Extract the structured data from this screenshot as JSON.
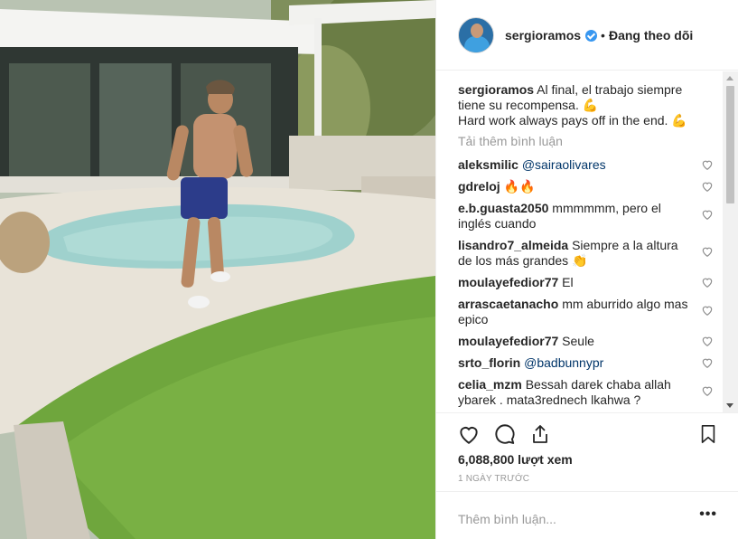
{
  "header": {
    "username": "sergioramos",
    "separator": "•",
    "follow_status": "Đang theo dõi"
  },
  "caption": {
    "username": "sergioramos",
    "text": "Al final, el trabajo siempre tiene su recompensa. 💪",
    "text_en": "Hard work always pays off in the end. 💪"
  },
  "load_more": "Tải thêm bình luận",
  "comments": [
    {
      "user": "aleksmilic",
      "text": "",
      "mention": "@sairaolivares"
    },
    {
      "user": "gdreloj",
      "text": "🔥🔥",
      "mention": ""
    },
    {
      "user": "e.b.guasta2050",
      "text": "mmmmmm, pero el inglés cuando",
      "mention": ""
    },
    {
      "user": "lisandro7_almeida",
      "text": "Siempre a la altura de los más grandes 👏",
      "mention": ""
    },
    {
      "user": "moulayefedior77",
      "text": "El",
      "mention": ""
    },
    {
      "user": "arrascaetanacho",
      "text": "mm aburrido algo mas epico",
      "mention": ""
    },
    {
      "user": "moulayefedior77",
      "text": "Seule",
      "mention": ""
    },
    {
      "user": "srto_florin",
      "text": "",
      "mention": "@badbunnypr"
    },
    {
      "user": "celia_mzm",
      "text": "Bessah darek chaba allah ybarek . mata3rednech lkahwa ?",
      "mention": ""
    }
  ],
  "stats": {
    "views": "6,088,800 lượt xem",
    "date": "1 NGÀY TRƯỚC"
  },
  "add_comment": {
    "placeholder": "Thêm bình luận...",
    "more": "•••"
  },
  "icons": {
    "like": "heart-icon",
    "comment": "comment-icon",
    "share": "share-icon",
    "save": "bookmark-icon",
    "verified": "verified-badge-icon"
  },
  "colors": {
    "link": "#003569",
    "muted": "#999999",
    "verified": "#3897f0",
    "text": "#262626"
  }
}
